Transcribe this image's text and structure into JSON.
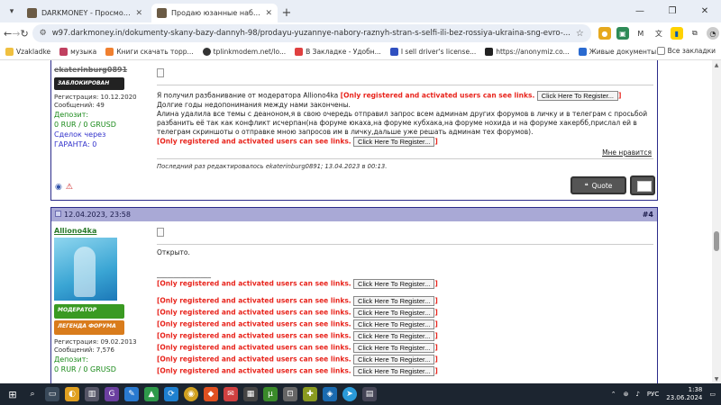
{
  "browser": {
    "tabs": [
      {
        "title": "DARKMONEY - Просмотр про...",
        "active": false
      },
      {
        "title": "Продаю юзанные наборы ра...",
        "active": true
      }
    ],
    "url": "w97.darkmoney.in/dokumenty-skany-bazy-dannyh-98/prodayu-yuzannye-nabory-raznyh-stran-s-selfi-ili-bez-rossiya-ukraina-sng-evro-...",
    "bookmarks": [
      "Vzakladke",
      "музыка",
      "Книги скачать торр...",
      "tplinkmodem.net/lo...",
      "В Закладке - Удобн...",
      "I sell driver's license...",
      "https://anonymiz.co...",
      "Живые документы..."
    ],
    "all_bookmarks": "Все закладки"
  },
  "posts": [
    {
      "user": {
        "name": "ekaterinburg0891",
        "rank": "ЗАБЛОКИРОВАН",
        "registered": "Регистрация: 10.12.2020",
        "messages": "Сообщений: 49",
        "deposit_label": "Депозит:",
        "deposit_value": "0 RUR / 0 GRUSD",
        "deal_label": "Сделок через",
        "deal_value": "ГАРАНТА: 0"
      },
      "lines": {
        "l1": "Я получил разбанивание от модератора Alliono4ka",
        "l2": "Долгие годы недопонимания между нами закончены.",
        "l3": "Алина удалила все темы с деаноном,я в свою очередь отправил запрос всем админам других форумов в личку и в телеграм с просьбой",
        "l4": "разбанить её так как конфликт исчерпан(на форуме юкаха,на форуме кубхака,на форуме нохида и на форуме хакербб,прислал ей в",
        "l5": "телеграм скриншоты о отправке мною запросов им в личку,дальше уже решать админам тех форумов)."
      },
      "likes": "Мне нравится",
      "edited": "Последний раз редактировалось ekaterinburg0891; 13.04.2023 в 00:13.",
      "quote": "Quote"
    },
    {
      "date": "12.04.2023, 23:58",
      "num": "#4",
      "user": {
        "name": "Alliono4ka",
        "rank1": "МОДЕРАТОР",
        "rank2": "ЛЕГЕНДА ФОРУМА",
        "registered": "Регистрация: 09.02.2013",
        "messages": "Сообщений: 7,576",
        "deposit_label": "Депозит:",
        "deposit_value": "0 RUR / 0 GRUSD"
      },
      "text": "Открыто.",
      "underline": "________________"
    }
  ],
  "hidden_notice": "[Only registered and activated users can see links.",
  "register_button": "Click Here To Register...",
  "bracket_close": "]",
  "taskbar": {
    "lang": "РУС",
    "time": "1:38",
    "date": "23.06.2024"
  }
}
